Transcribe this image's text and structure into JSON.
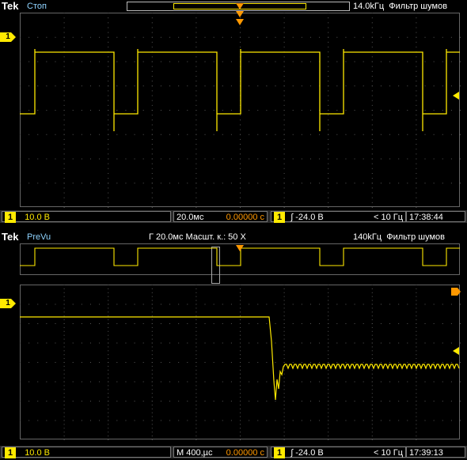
{
  "panel1": {
    "brand": "Tek",
    "state": "Стоп",
    "sample_rate": "14.0kГц",
    "filter": "Фильтр шумов",
    "channel_marker": "1",
    "bottom": {
      "ch_num": "1",
      "volts": "10.0 В",
      "timebase": "20.0мс",
      "position": "0.00000 с",
      "trig_ch": "1",
      "trig_level": "-24.0 В",
      "freq": "< 10 Гц",
      "time": "17:38:44"
    }
  },
  "panel2": {
    "brand": "Tek",
    "state": "PreVu",
    "timebase_info": "Г 20.0мс  Масшт. к.: 50 X",
    "sample_rate": "140kГц",
    "filter": "Фильтр шумов",
    "channel_marker": "1",
    "bottom": {
      "ch_num": "1",
      "volts": "10.0 В",
      "timebase": "М 400,µс",
      "position": "0.00000 с",
      "trig_ch": "1",
      "trig_level": "-24.0 В",
      "freq": "< 10 Гц",
      "time": "17:39:13"
    }
  },
  "colors": {
    "trace": "#ffea00",
    "trigger": "#ff9800",
    "grid": "#555555"
  }
}
